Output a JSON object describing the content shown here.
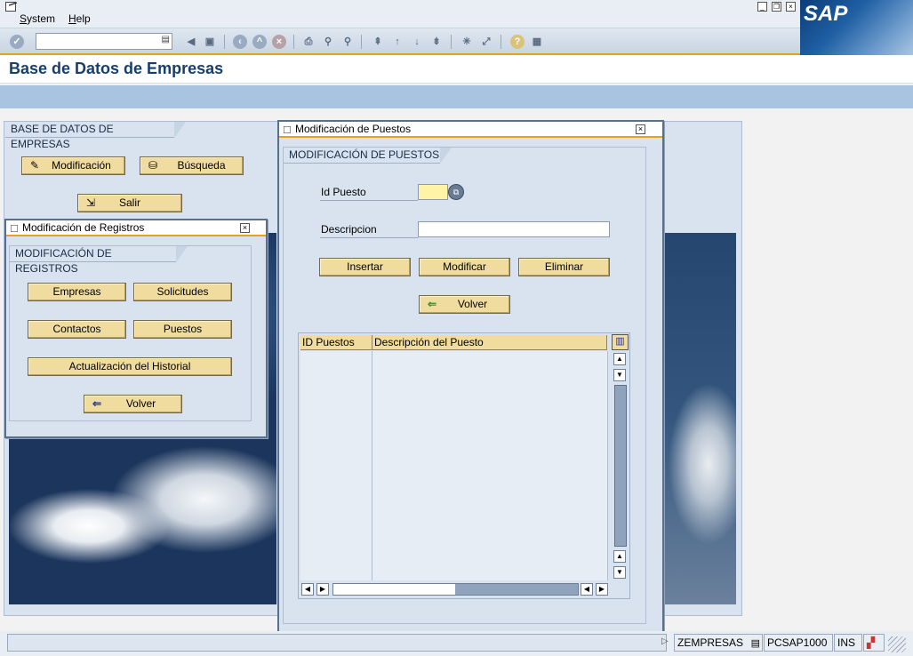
{
  "menu": {
    "system": "System",
    "help": "Help"
  },
  "logo": "SAP",
  "toolbar": {
    "command_value": ""
  },
  "page_title": "Base de Datos de Empresas",
  "main_panel": {
    "group_title": "BASE DE DATOS DE EMPRESAS",
    "buttons": {
      "modificacion": "Modificación",
      "busqueda": "Búsqueda",
      "salir": "Salir"
    }
  },
  "registros_dialog": {
    "title": "Modificación de Registros",
    "group_title": "MODIFICACIÓN DE REGISTROS",
    "buttons": {
      "empresas": "Empresas",
      "solicitudes": "Solicitudes",
      "contactos": "Contactos",
      "puestos": "Puestos",
      "historial": "Actualización del Historial",
      "volver": "Volver"
    }
  },
  "puestos_dialog": {
    "title": "Modificación de Puestos",
    "group_title": "MODIFICACIÓN DE PUESTOS",
    "id_label": "Id Puesto",
    "id_value": "",
    "desc_label": "Descripcion",
    "desc_value": "",
    "buttons": {
      "insertar": "Insertar",
      "modificar": "Modificar",
      "eliminar": "Eliminar",
      "volver": "Volver"
    },
    "table": {
      "columns": [
        "ID Puestos",
        "Descripción del Puesto"
      ],
      "rows": [
        [
          "",
          ""
        ],
        [
          "",
          ""
        ],
        [
          "",
          ""
        ],
        [
          "",
          ""
        ],
        [
          "",
          ""
        ],
        [
          "",
          ""
        ],
        [
          "",
          ""
        ],
        [
          "",
          ""
        ],
        [
          "",
          ""
        ],
        [
          "",
          ""
        ],
        [
          "",
          ""
        ],
        [
          "",
          ""
        ],
        [
          "",
          ""
        ]
      ]
    }
  },
  "status": {
    "transaction": "ZEMPRESAS",
    "server": "PCSAP1000",
    "mode": "INS"
  },
  "colors": {
    "button": "#f0dc9e",
    "accent": "#e4a11b",
    "panel": "#d8e3ef",
    "title": "#173f6e"
  }
}
